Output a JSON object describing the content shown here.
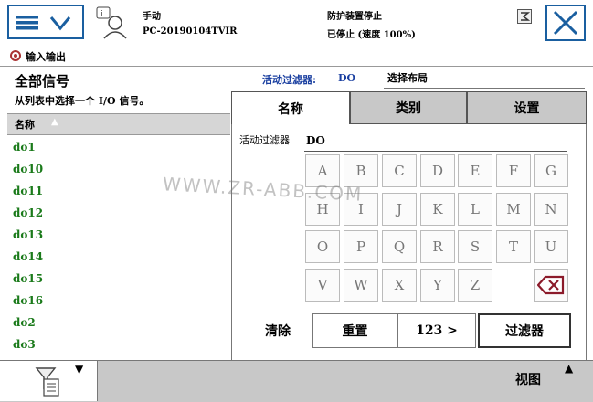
{
  "header": {
    "mode": "手动",
    "controller": "PC-20190104TVIR",
    "status_line1": "防护装置停止",
    "status_line2": "已停止 (速度 100%)"
  },
  "app": {
    "title": "输入输出"
  },
  "left": {
    "title": "全部信号",
    "subtitle": "从列表中选择一个 I/O 信号。",
    "column_header": "名称",
    "signals": [
      "do1",
      "do10",
      "do11",
      "do12",
      "do13",
      "do14",
      "do15",
      "do16",
      "do2",
      "do3"
    ]
  },
  "filter_bar": {
    "label": "活动过滤器:",
    "value": "DO",
    "layout": "选择布局"
  },
  "tabs": [
    "名称",
    "类别",
    "设置"
  ],
  "filter_input": {
    "label": "活动过滤器",
    "value": "DO"
  },
  "keyboard": {
    "row1": [
      "A",
      "B",
      "C",
      "D",
      "E",
      "F",
      "G"
    ],
    "row2": [
      "H",
      "I",
      "J",
      "K",
      "L",
      "M",
      "N"
    ],
    "row3": [
      "O",
      "P",
      "Q",
      "R",
      "S",
      "T",
      "U"
    ],
    "row4": [
      "V",
      "W",
      "X",
      "Y",
      "Z"
    ]
  },
  "buttons": {
    "clear": "清除",
    "reset": "重置",
    "numeric": "123 >",
    "filter": "过滤器"
  },
  "bottom": {
    "view": "视图"
  },
  "watermark": "WWW.ZR-ABB.COM",
  "colors": {
    "accent": "#1a5fa0",
    "signal_text": "#1a7a1a",
    "tab_inactive": "#c8c8c8"
  }
}
